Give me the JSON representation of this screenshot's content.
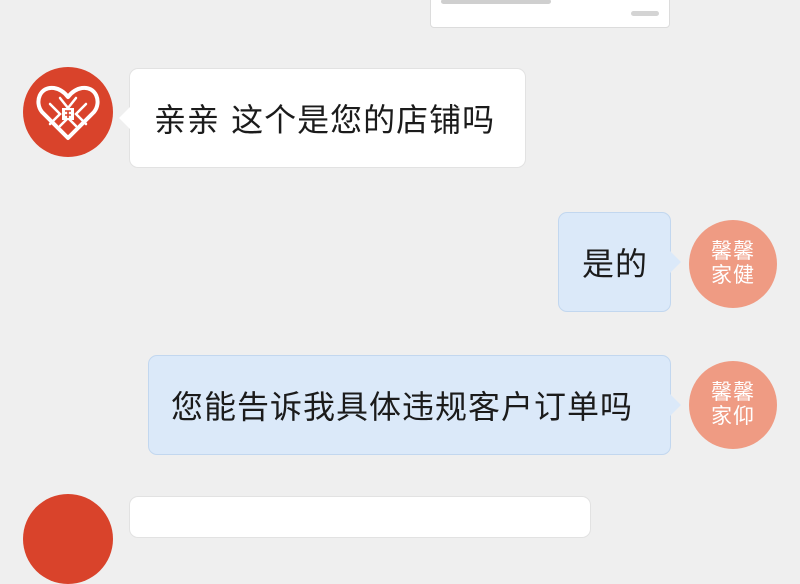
{
  "colors": {
    "background": "#efefef",
    "shop_avatar": "#d9432b",
    "user_avatar": "#ef9b83",
    "left_bubble": "#ffffff",
    "right_bubble": "#dbe9f9"
  },
  "messages": [
    {
      "side": "left",
      "avatar": "pinduoduo-logo-icon",
      "text": "亲亲 这个是您的店铺吗"
    },
    {
      "side": "right",
      "avatar_line1": "馨馨",
      "avatar_line2": "家健",
      "text": "是的"
    },
    {
      "side": "right",
      "avatar_line1": "馨馨",
      "avatar_line2": "家仰",
      "text": "您能告诉我具体违规客户订单吗"
    }
  ]
}
